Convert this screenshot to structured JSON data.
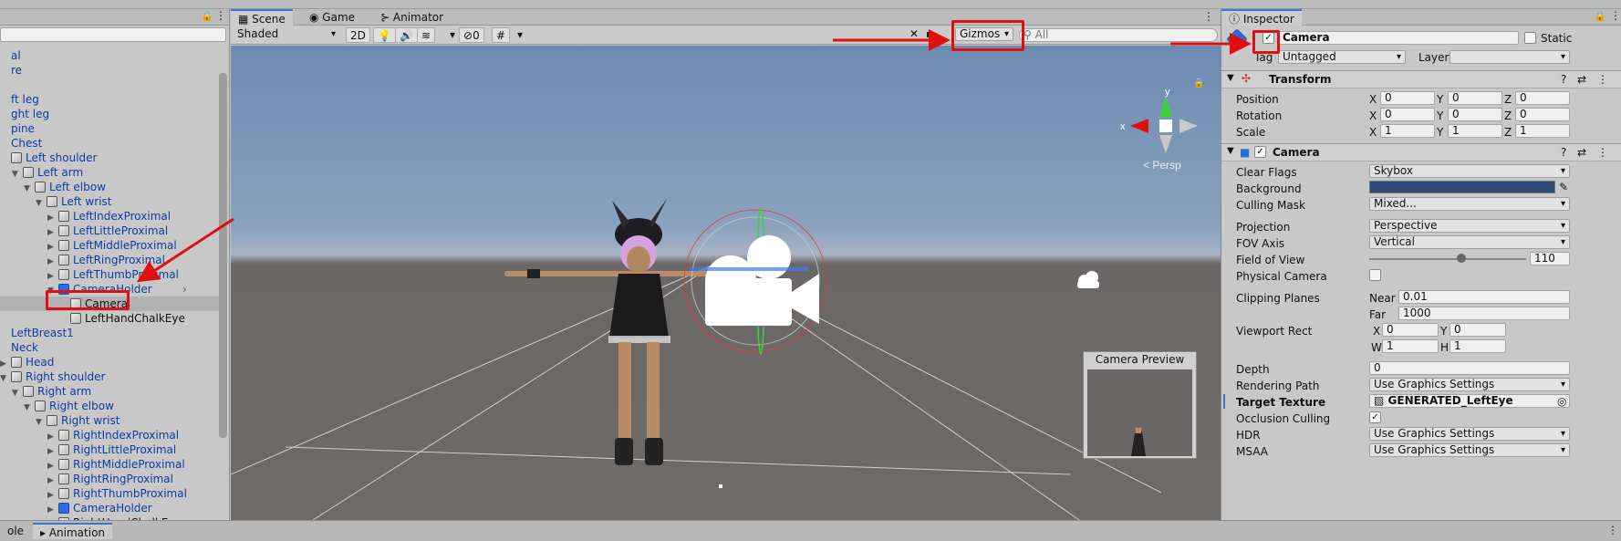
{
  "hierarchy": {
    "rows": [
      {
        "label": "al",
        "indent": 0,
        "arrow": "",
        "icon": "none"
      },
      {
        "label": "re",
        "indent": 0,
        "arrow": "",
        "icon": "none"
      },
      {
        "label": "",
        "indent": 0,
        "arrow": "",
        "icon": "none"
      },
      {
        "label": "ft leg",
        "indent": 0,
        "arrow": "",
        "icon": "none"
      },
      {
        "label": "ght leg",
        "indent": 0,
        "arrow": "",
        "icon": "none"
      },
      {
        "label": "pine",
        "indent": 0,
        "arrow": "",
        "icon": "none"
      },
      {
        "label": "Chest",
        "indent": 0,
        "arrow": "",
        "icon": "none"
      },
      {
        "label": "Left shoulder",
        "indent": 0,
        "arrow": "",
        "icon": "cube"
      },
      {
        "label": "Left arm",
        "indent": 1,
        "arrow": "▼",
        "icon": "cube"
      },
      {
        "label": "Left elbow",
        "indent": 2,
        "arrow": "▼",
        "icon": "cube"
      },
      {
        "label": "Left wrist",
        "indent": 3,
        "arrow": "▼",
        "icon": "cube"
      },
      {
        "label": "LeftIndexProximal",
        "indent": 4,
        "arrow": "▶",
        "icon": "cube"
      },
      {
        "label": "LeftLittleProximal",
        "indent": 4,
        "arrow": "▶",
        "icon": "cube"
      },
      {
        "label": "LeftMiddleProximal",
        "indent": 4,
        "arrow": "▶",
        "icon": "cube"
      },
      {
        "label": "LeftRingProximal",
        "indent": 4,
        "arrow": "▶",
        "icon": "cube"
      },
      {
        "label": "LeftThumbProximal",
        "indent": 4,
        "arrow": "▶",
        "icon": "cube"
      },
      {
        "label": "CameraHolder",
        "indent": 4,
        "arrow": "▼",
        "icon": "blue"
      },
      {
        "label": "Camera",
        "indent": 5,
        "arrow": "",
        "icon": "cube",
        "selected": true
      },
      {
        "label": "LeftHandChalkEye",
        "indent": 5,
        "arrow": "",
        "icon": "cube"
      },
      {
        "label": "LeftBreast1",
        "indent": 0,
        "arrow": "",
        "icon": "none"
      },
      {
        "label": "Neck",
        "indent": 0,
        "arrow": "",
        "icon": "none"
      },
      {
        "label": "Head",
        "indent": 0,
        "arrow": "▶",
        "icon": "cube"
      },
      {
        "label": "Right shoulder",
        "indent": 0,
        "arrow": "▼",
        "icon": "cube"
      },
      {
        "label": "Right arm",
        "indent": 1,
        "arrow": "▼",
        "icon": "cube"
      },
      {
        "label": "Right elbow",
        "indent": 2,
        "arrow": "▼",
        "icon": "cube"
      },
      {
        "label": "Right wrist",
        "indent": 3,
        "arrow": "▼",
        "icon": "cube"
      },
      {
        "label": "RightIndexProximal",
        "indent": 4,
        "arrow": "▶",
        "icon": "cube"
      },
      {
        "label": "RightLittleProximal",
        "indent": 4,
        "arrow": "▶",
        "icon": "cube"
      },
      {
        "label": "RightMiddleProximal",
        "indent": 4,
        "arrow": "▶",
        "icon": "cube"
      },
      {
        "label": "RightRingProximal",
        "indent": 4,
        "arrow": "▶",
        "icon": "cube"
      },
      {
        "label": "RightThumbProximal",
        "indent": 4,
        "arrow": "▶",
        "icon": "cube"
      },
      {
        "label": "CameraHolder",
        "indent": 4,
        "arrow": "▶",
        "icon": "blue"
      },
      {
        "label": "RightHandChalkEye",
        "indent": 4,
        "arrow": "",
        "icon": "cube"
      }
    ]
  },
  "scene": {
    "tabs": [
      "Scene",
      "Game",
      "Animator"
    ],
    "shading": "Shaded",
    "mode_2d": "2D",
    "hidden_count": "0",
    "gizmos": "Gizmos",
    "search_placeholder": "All",
    "persp_label": "< Persp",
    "axis_y": "y",
    "axis_x": "x",
    "camera_preview_title": "Camera Preview"
  },
  "inspector": {
    "tab": "Inspector",
    "object_name": "Camera",
    "static_label": "Static",
    "tag_label": "Tag",
    "tag_value": "Untagged",
    "layer_label": "Layer",
    "layer_value": "",
    "transform": {
      "title": "Transform",
      "rows": [
        {
          "label": "Position",
          "x": "0",
          "y": "0",
          "z": "0"
        },
        {
          "label": "Rotation",
          "x": "0",
          "y": "0",
          "z": "0"
        },
        {
          "label": "Scale",
          "x": "1",
          "y": "1",
          "z": "1"
        }
      ]
    },
    "camera": {
      "title": "Camera",
      "clear_flags_label": "Clear Flags",
      "clear_flags": "Skybox",
      "background_label": "Background",
      "background_color": "#2d4a74",
      "culling_mask_label": "Culling Mask",
      "culling_mask": "Mixed...",
      "projection_label": "Projection",
      "projection": "Perspective",
      "fov_axis_label": "FOV Axis",
      "fov_axis": "Vertical",
      "fov_label": "Field of View",
      "fov_value": "110",
      "fov_fraction": 0.59,
      "physical_label": "Physical Camera",
      "clipping_label": "Clipping Planes",
      "near_label": "Near",
      "near": "0.01",
      "far_label": "Far",
      "far": "1000",
      "viewport_label": "Viewport Rect",
      "vx": "0",
      "vy": "0",
      "vw": "1",
      "vh": "1",
      "depth_label": "Depth",
      "depth": "0",
      "rendering_label": "Rendering Path",
      "rendering": "Use Graphics Settings",
      "target_label": "Target Texture",
      "target": "GENERATED_LeftEye",
      "occlusion_label": "Occlusion Culling",
      "hdr_label": "HDR",
      "hdr": "Use Graphics Settings",
      "msaa_label": "MSAA",
      "msaa": "Use Graphics Settings"
    }
  },
  "bottom": {
    "tabs": [
      "ole",
      "Animation"
    ]
  },
  "colors": {
    "accent": "#3a78d8",
    "annotation": "#e01010",
    "link": "#0b3f9a"
  }
}
